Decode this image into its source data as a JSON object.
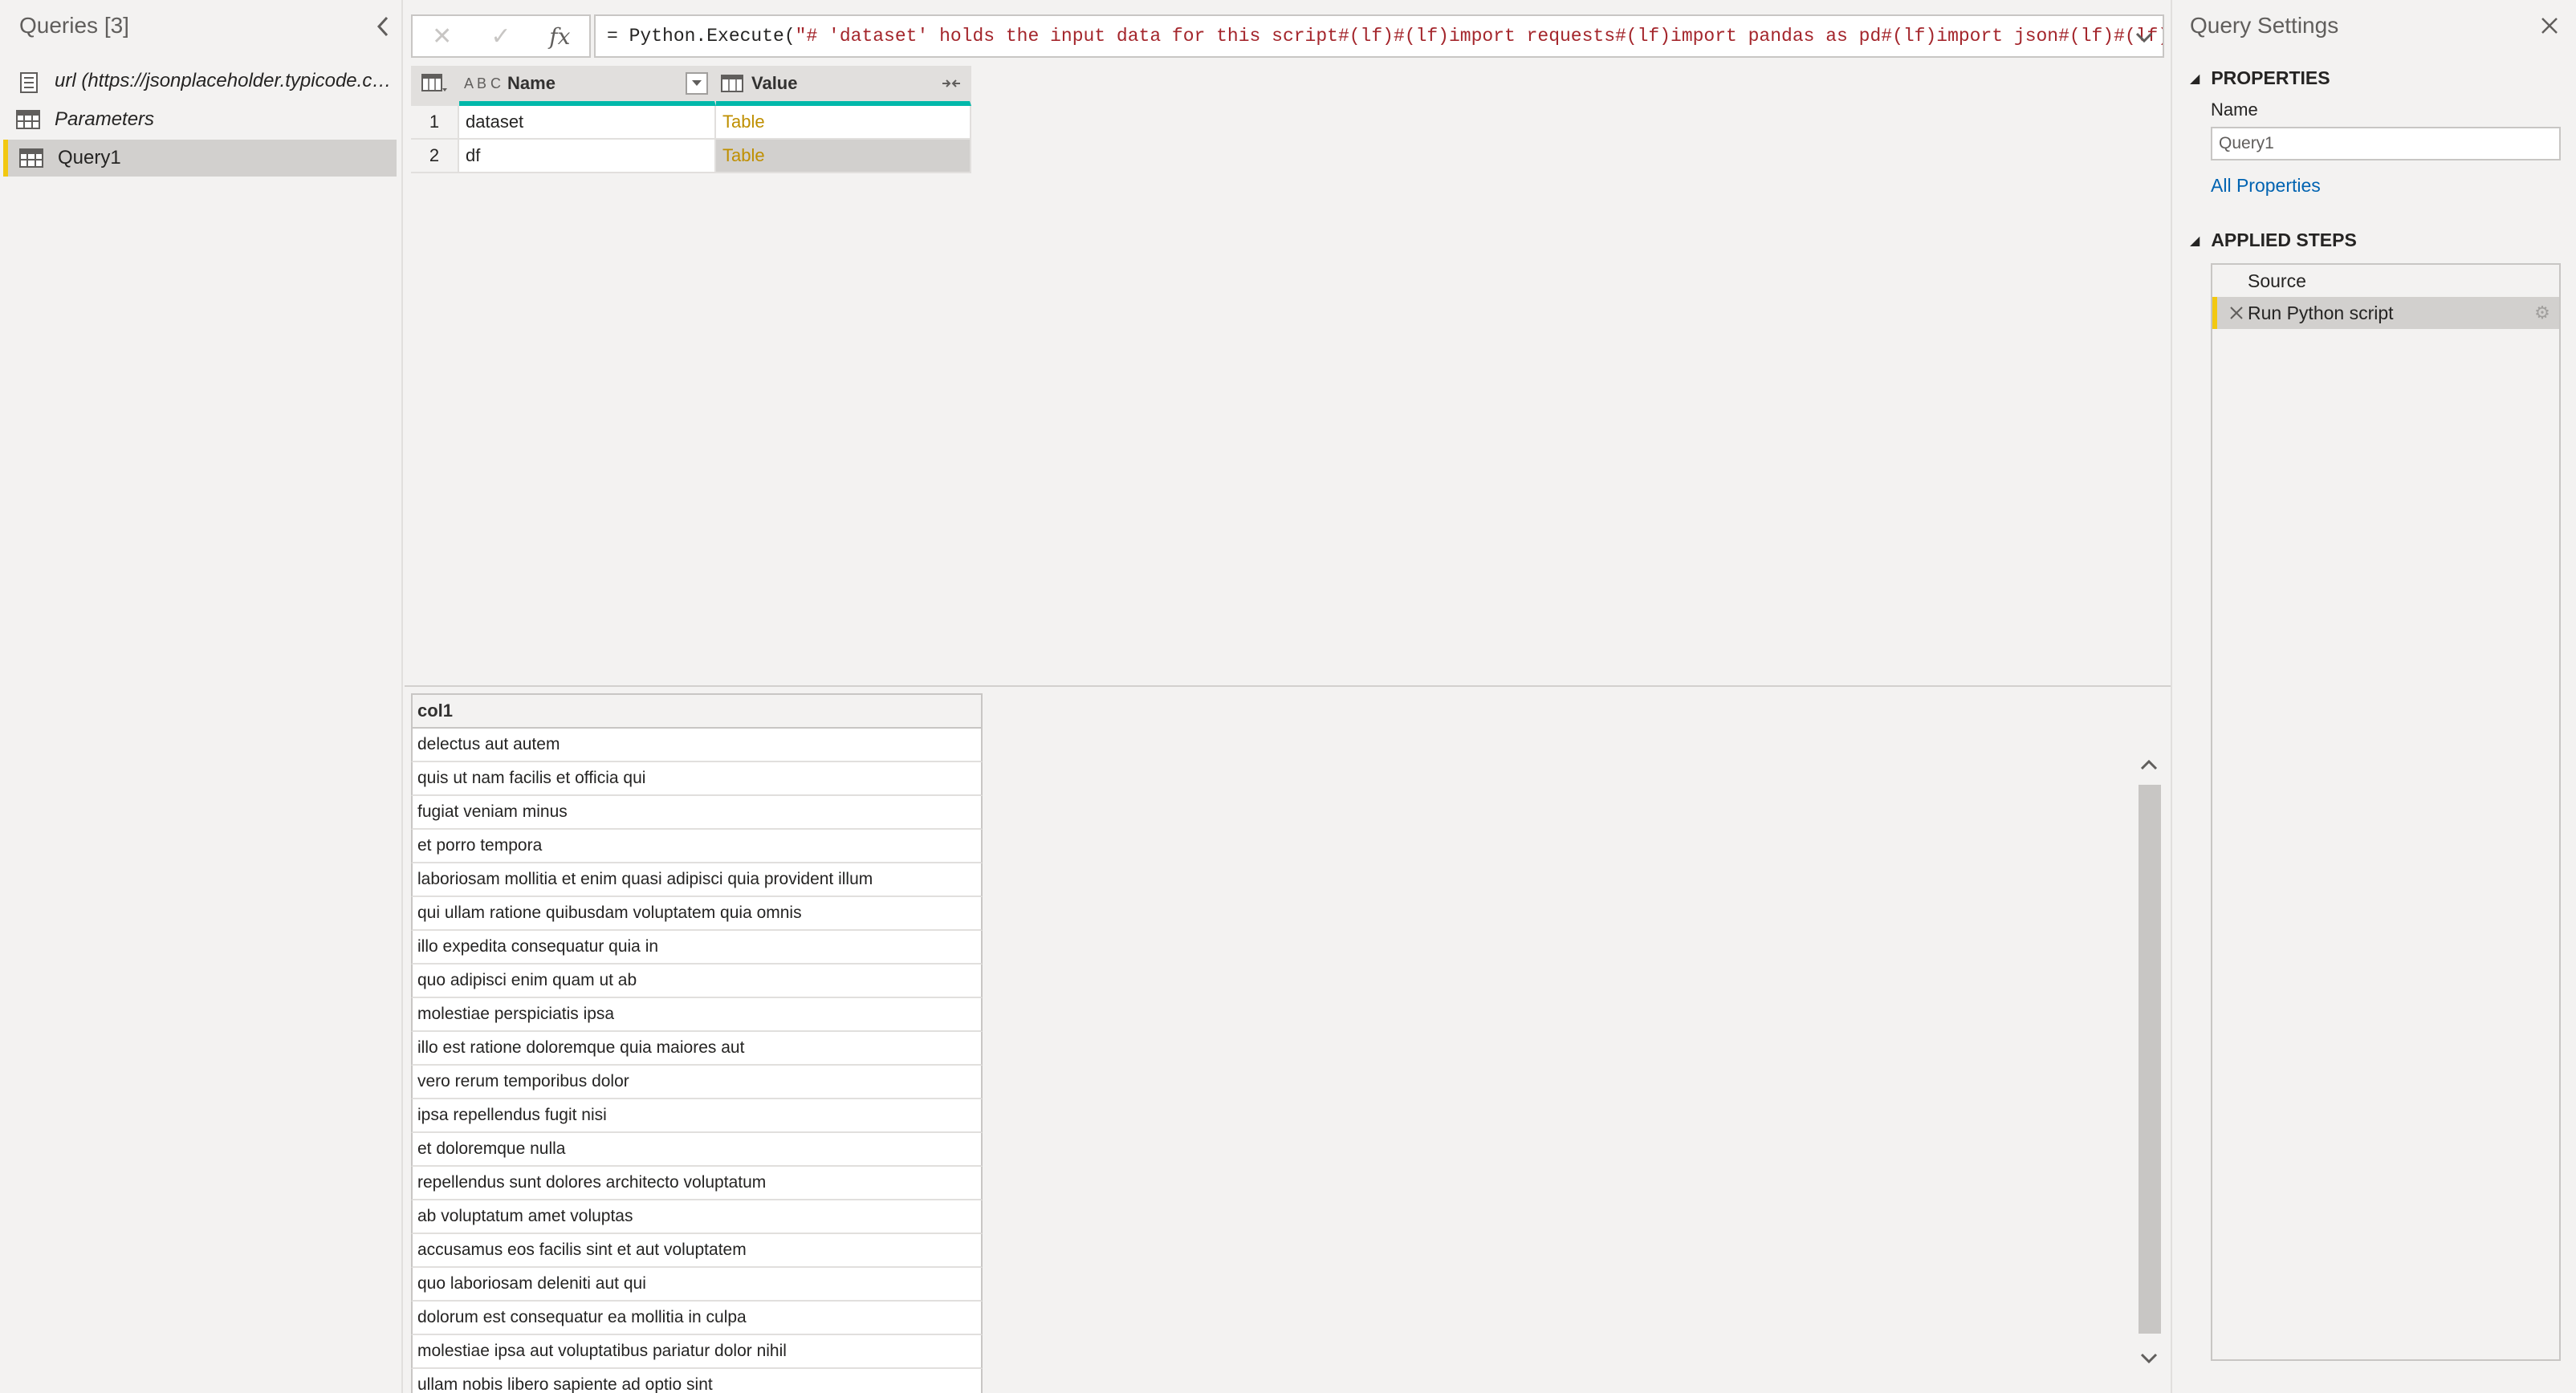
{
  "queries_pane": {
    "title": "Queries [3]",
    "items": [
      {
        "label": "url (https://jsonplaceholder.typicode.co...",
        "icon": "parameter-icon",
        "italic": true
      },
      {
        "label": "Parameters",
        "icon": "table-icon",
        "italic": true
      },
      {
        "label": "Query1",
        "icon": "table-icon",
        "italic": false,
        "selected": true
      }
    ]
  },
  "formula_bar": {
    "cancel_icon": "✕",
    "commit_icon": "✓",
    "fx_label": "fx",
    "prefix": "= Python.Execute(",
    "formula": "\"# 'dataset' holds the input data for this script#(lf)#(lf)import requests#(lf)import pandas as pd#(lf)import json#(lf)#(lf)"
  },
  "top_grid": {
    "columns": [
      {
        "name": "Name",
        "type_label": "A B C"
      },
      {
        "name": "Value",
        "type_label": ""
      }
    ],
    "rows": [
      {
        "index": "1",
        "name": "dataset",
        "value": "Table"
      },
      {
        "index": "2",
        "name": "df",
        "value": "Table"
      }
    ]
  },
  "preview_grid": {
    "column": "col1",
    "rows": [
      "delectus aut autem",
      "quis ut nam facilis et officia qui",
      "fugiat veniam minus",
      "et porro tempora",
      "laboriosam mollitia et enim quasi adipisci quia provident illum",
      "qui ullam ratione quibusdam voluptatem quia omnis",
      "illo expedita consequatur quia in",
      "quo adipisci enim quam ut ab",
      "molestiae perspiciatis ipsa",
      "illo est ratione doloremque quia maiores aut",
      "vero rerum temporibus dolor",
      "ipsa repellendus fugit nisi",
      "et doloremque nulla",
      "repellendus sunt dolores architecto voluptatum",
      "ab voluptatum amet voluptas",
      "accusamus eos facilis sint et aut voluptatem",
      "quo laboriosam deleniti aut qui",
      "dolorum est consequatur ea mollitia in culpa",
      "molestiae ipsa aut voluptatibus pariatur dolor nihil",
      "ullam nobis libero sapiente ad optio sint"
    ]
  },
  "settings_pane": {
    "title": "Query Settings",
    "properties_heading": "PROPERTIES",
    "name_label": "Name",
    "name_value": "Query1",
    "all_properties_link": "All Properties",
    "applied_steps_heading": "APPLIED STEPS",
    "steps": [
      {
        "label": "Source",
        "selected": false
      },
      {
        "label": "Run Python script",
        "selected": true
      }
    ]
  },
  "colors": {
    "accent_yellow": "#f2c811",
    "header_teal": "#01b8aa",
    "value_gold": "#bf8f00",
    "link_blue": "#0063b1",
    "formula_red": "#a4262c"
  }
}
